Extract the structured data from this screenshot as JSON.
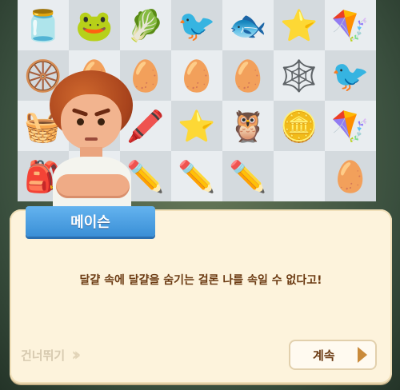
{
  "board": {
    "rows": [
      [
        "🫙",
        "🐸",
        "🥬",
        "🐦",
        "🐟",
        "⭐",
        "🪁"
      ],
      [
        "🛞",
        "🥚",
        "🥚",
        "🥚",
        "🥚",
        "🕸️",
        "🐦"
      ],
      [
        "🧺",
        "",
        "🖍️",
        "⭐",
        "🦉",
        "🪙",
        "🪁"
      ],
      [
        "🎒",
        "",
        "✏️",
        "✏️",
        "✏️",
        "",
        "🥚"
      ]
    ]
  },
  "dialog": {
    "speaker": "메이슨",
    "text": "달걀 속에 달걀을 숨기는 걸론 나를 속일 수 없다고!",
    "skip_label": "건너뛰기",
    "continue_label": "계속"
  },
  "icons": {
    "skip": "double-chevron-right-icon",
    "continue": "play-icon"
  },
  "colors": {
    "nameplate": "#3a8fd6",
    "dialog_bg": "#fdf3dc",
    "text": "#6b3a12"
  }
}
